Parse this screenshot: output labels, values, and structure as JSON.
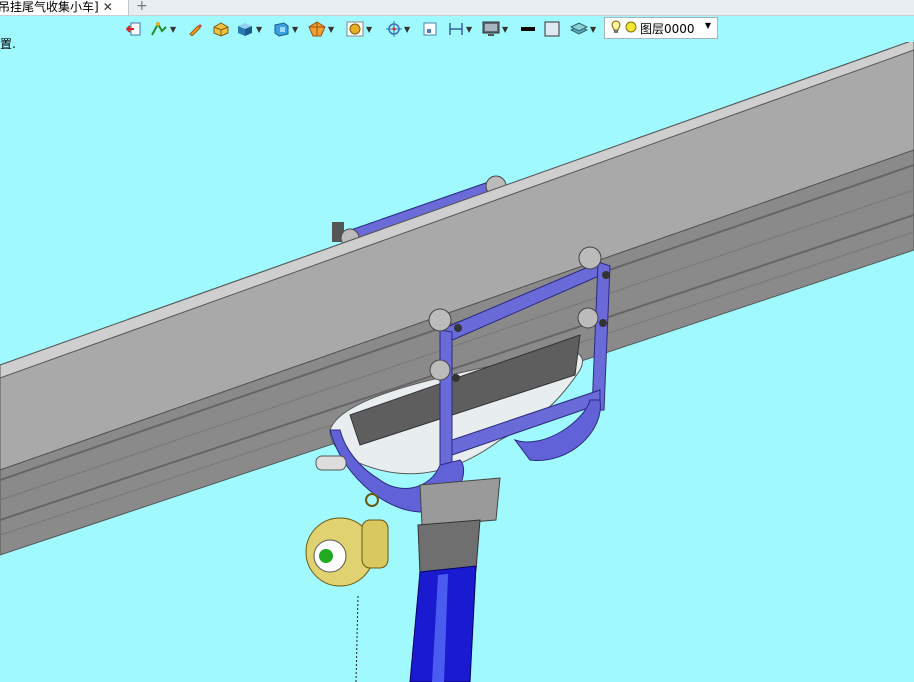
{
  "window": {
    "tab_title": "吊挂尾气收集小车]",
    "close_glyph": "✕",
    "add_tab_glyph": "+"
  },
  "status": {
    "text": "置."
  },
  "toolbar": {
    "icons": [
      "exit-sketch-icon",
      "sketch-tools-icon",
      "edit-icon",
      "solid-box-icon",
      "shaded-cube-icon",
      "view-orient-icon",
      "section-view-icon",
      "render-icon",
      "crosshair-icon",
      "frame-icon",
      "dimension-icon",
      "monitor-icon",
      "line-color-swatch",
      "fill-color-swatch",
      "layer-manager-icon"
    ],
    "layer": {
      "value": "图层0000",
      "icons": [
        "bulb-icon",
        "layer-color-dot"
      ]
    }
  },
  "colors": {
    "background": "#9ff9ff",
    "rail": "#a8a8a8",
    "bracket": "#6262d8",
    "hose": "#1a1ad0",
    "reel": "#e0d270"
  }
}
